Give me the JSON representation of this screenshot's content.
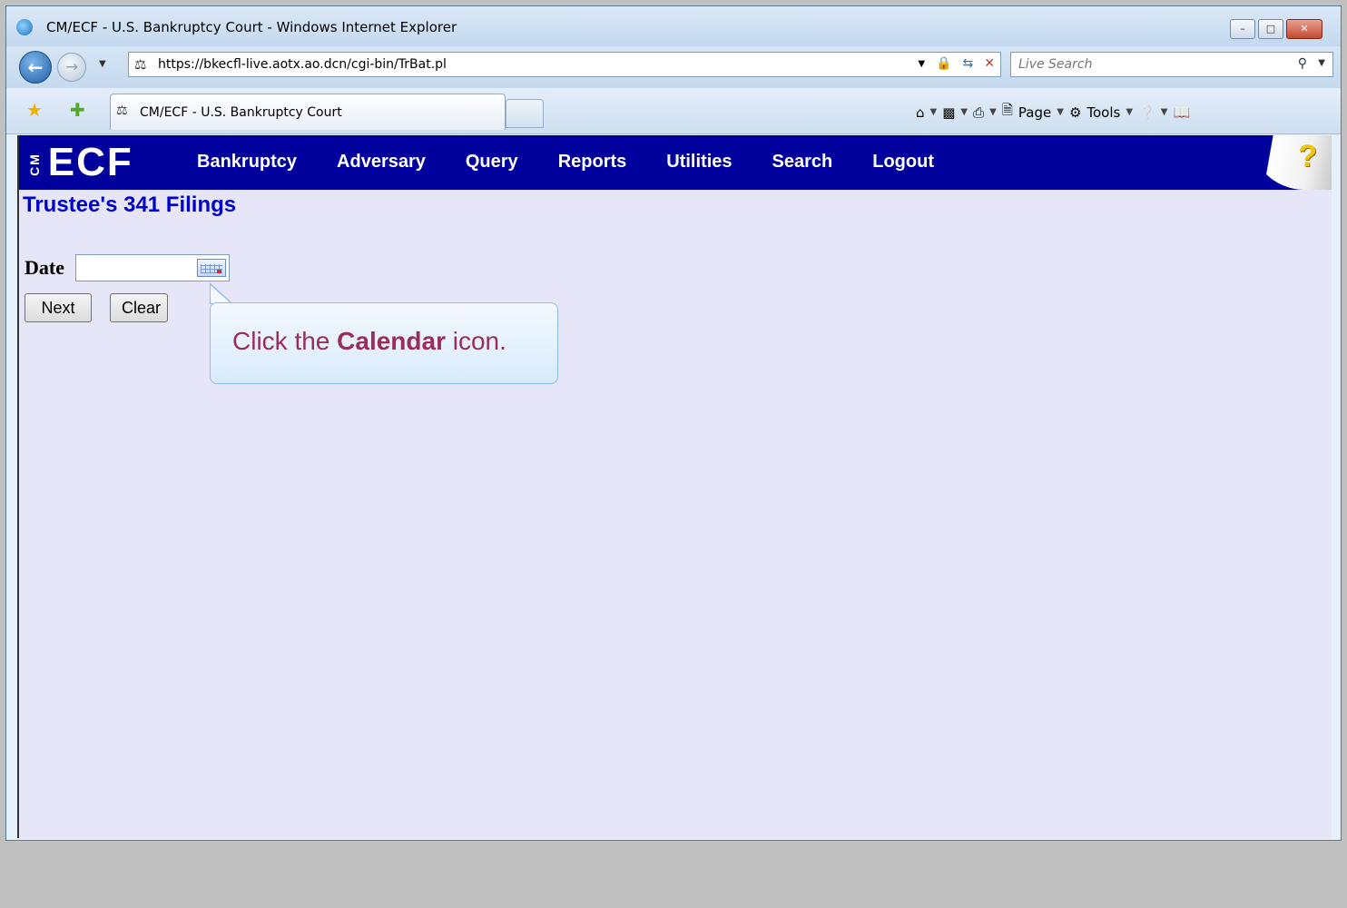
{
  "window": {
    "title": "CM/ECF - U.S. Bankruptcy Court - Windows Internet Explorer",
    "controls": {
      "minimize": "–",
      "maximize": "□",
      "close": "✕"
    }
  },
  "nav": {
    "back_icon": "back-arrow-icon",
    "forward_icon": "forward-arrow-icon",
    "address": "https://bkecfl-live.aotx.ao.dcn/cgi-bin/TrBat.pl",
    "search_placeholder": "Live Search"
  },
  "tabs": {
    "active_label": "CM/ECF - U.S. Bankruptcy Court"
  },
  "commandbar": {
    "page_label": "Page",
    "tools_label": "Tools"
  },
  "ecf": {
    "logo_small": "CM",
    "logo": "ECF",
    "menu": [
      "Bankruptcy",
      "Adversary",
      "Query",
      "Reports",
      "Utilities",
      "Search",
      "Logout"
    ],
    "help_icon": "?",
    "colors": {
      "header": "#00009c",
      "title": "#0000cc",
      "callout_text": "#9b2d5a"
    }
  },
  "form": {
    "page_title": "Trustee's 341 Filings",
    "date_label": "Date",
    "date_value": "",
    "next_label": "Next",
    "clear_label": "Clear"
  },
  "callout": {
    "prefix": "Click the ",
    "emphasis": "Calendar",
    "suffix": " icon."
  }
}
